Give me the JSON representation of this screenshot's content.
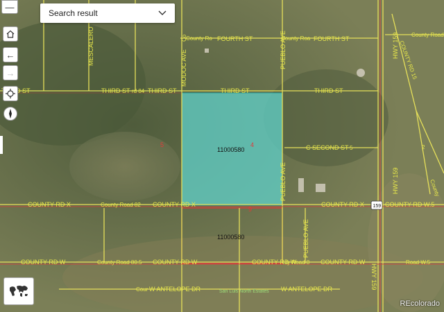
{
  "search": {
    "label": "Search result"
  },
  "parcel": {
    "id": "11000580",
    "id_lower": "11000580"
  },
  "section_numbers": [
    "5",
    "4",
    "9"
  ],
  "roads": {
    "county_ro_top": "County Ro",
    "fourth_st_1": "FOURTH ST",
    "county_road_top_mid": "County Roa",
    "fourth_st_2": "FOURTH ST",
    "county_road_right": "County Road",
    "third_st_left": "THIRD ST",
    "third_st_c": "THIRD ST",
    "third_st_rd84": "rd 84",
    "third_st_2": "THIRD ST",
    "third_st_3": "THIRD ST",
    "third_st_4": "THIRD ST",
    "second_st": "SECOND ST",
    "second_st_c": "C",
    "second_st_5": "5",
    "county_rd_x_1": "COUNTY RD X",
    "county_road_82": "County Road 82",
    "county_rd_x_2": "COUNTY RD X",
    "county_rd_x_3": "COUNTY RD X",
    "county_rd_w5": "COUNTY RD W.5",
    "hwy_shield": "159",
    "county_rd_w_1": "COUNTY RD W",
    "county_road_805": "County Road 80.5",
    "county_rd_w_2": "COUNTY RD W",
    "county_rd_w_3": "COUNTY RD W",
    "county_road_8": "ty Road 8",
    "county_rd_w_4": "COUNTY RD W",
    "road_w5": "Road W.5",
    "antelope_dr_cour": "Cour",
    "antelope_dr_1": "W ANTELOPE DR",
    "antelope_dr_2": "W ANTELOPE DR",
    "san_luis": "San Luis North Estates",
    "mescalero": "MESCALERO",
    "pueblo_ave_top": "PUEBLO AVE",
    "pueblo_ave_mid": "PUEBLO AVE",
    "pueblo_ave_low": "PUEBLO AVE",
    "pueblo_ave_bottom": "PUEBLO AVE",
    "modoc_ave": "MODOC AVE",
    "modoc_county": "Co",
    "hwy_159_1": "HWY 159",
    "hwy_159_2": "HWY 159",
    "hwy_159_3": "HWY 159",
    "county_rd_15": "COUNTY RD 15",
    "county_rd_right": "County",
    "county_rd_right_2": "2"
  },
  "credit": "REcolorado",
  "colors": {
    "parcel_fill": "#5fd6d0",
    "parcel_stroke": "#2a9d96",
    "road": "#e6e05a",
    "road_label": "#e8e84a",
    "parcel_outline": "#e23a3a"
  }
}
